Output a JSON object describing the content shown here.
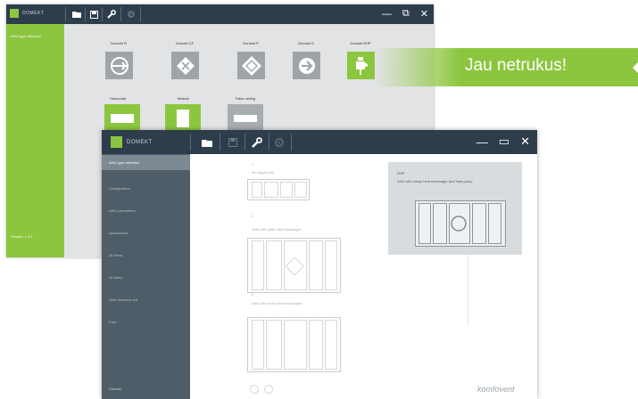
{
  "back_window": {
    "logo_text": "DOMEKT",
    "sidebar_item": "AHU type selection",
    "version": "Version: 1.0.2",
    "window_controls": [
      "—",
      "⧉",
      "✕"
    ],
    "units": [
      {
        "label": "Domekt R",
        "icon": "rotor-icon",
        "active": false
      },
      {
        "label": "Domekt CF",
        "icon": "counterflow-icon",
        "active": false
      },
      {
        "label": "Domekt P",
        "icon": "plate-icon",
        "active": false
      },
      {
        "label": "Domekt S",
        "icon": "arrow-icon",
        "active": false
      },
      {
        "label": "Domekt RHP",
        "icon": "heatpump-icon",
        "active": true
      }
    ],
    "mounting": [
      {
        "label": "Horizontal",
        "active": true
      },
      {
        "label": "Vertical",
        "active": true
      },
      {
        "label": "False ceiling",
        "active": false
      }
    ]
  },
  "banner": {
    "text": "Jau netrukus!"
  },
  "front_window": {
    "logo_text": "DOMEKT",
    "nav": [
      {
        "label": "AHU type selection",
        "active": true
      },
      {
        "label": "Configuration",
        "active": false
      },
      {
        "label": "AHU parameters",
        "active": false
      },
      {
        "label": "Accessories",
        "active": false
      },
      {
        "label": "Air flows",
        "active": false
      },
      {
        "label": "Air filters",
        "active": false
      },
      {
        "label": "Heat recovery unit",
        "active": false
      },
      {
        "label": "Print",
        "active": false
      }
    ],
    "side_footer": "Domekt",
    "options": [
      {
        "num": "1",
        "text": "Air supply unit"
      },
      {
        "num": "2",
        "text": "AHU with plate heat exchanger"
      },
      {
        "num": "3",
        "text": "AHU with rotary heat exchanger"
      }
    ],
    "preview": {
      "title": "RHP",
      "desc": "AHU with rotary heat exchanger and heat pump"
    },
    "brand": "komfovent",
    "window_controls": [
      "—",
      "▭",
      "✕"
    ],
    "colors": {
      "titlebar": "#2e3d4c",
      "accent": "#8cc63f",
      "sidebar": "#4e5d68"
    }
  }
}
